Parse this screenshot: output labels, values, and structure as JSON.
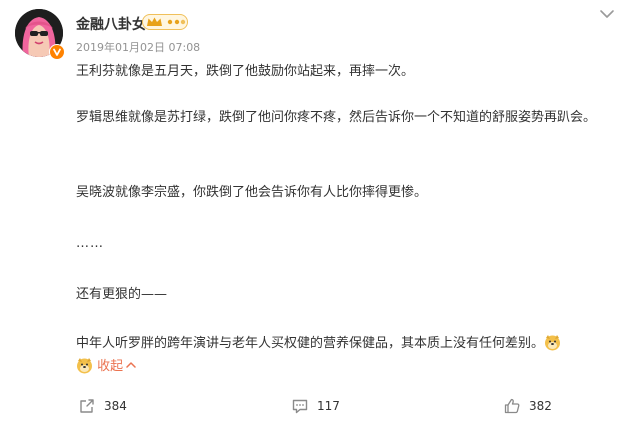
{
  "post": {
    "author": "金融八卦女",
    "timestamp": "2019年01月02日 07:08",
    "paragraphs": [
      "王利芬就像是五月天，跌倒了他鼓励你站起来，再摔一次。",
      "罗辑思维就像是苏打绿，跌倒了他问你疼不疼，然后告诉你一个不知道的舒服姿势再趴会。",
      "吴晓波就像李宗盛，你跌倒了他会告诉你有人比你摔得更惨。",
      "……",
      "还有更狠的——",
      "中年人听罗胖的跨年演讲与老年人买权健的营养保健品，其本质上没有任何差别。"
    ],
    "collapse_label": "收起"
  },
  "icons": {
    "verified": "verified-v-icon",
    "vip": "vip-crown-badge-icon",
    "more": "chevron-down-icon",
    "doge": "doge-emoji-icon",
    "repost": "repost-icon",
    "comment": "comment-icon",
    "like": "thumbs-up-icon",
    "collapse_arrow": "chevron-up-icon"
  },
  "actions": {
    "repost_count": "384",
    "comment_count": "117",
    "like_count": "382"
  },
  "colors": {
    "accent": "#eb7350",
    "verified": "#ff8200",
    "muted": "#939393",
    "avatar_pink": "#f0659d"
  }
}
